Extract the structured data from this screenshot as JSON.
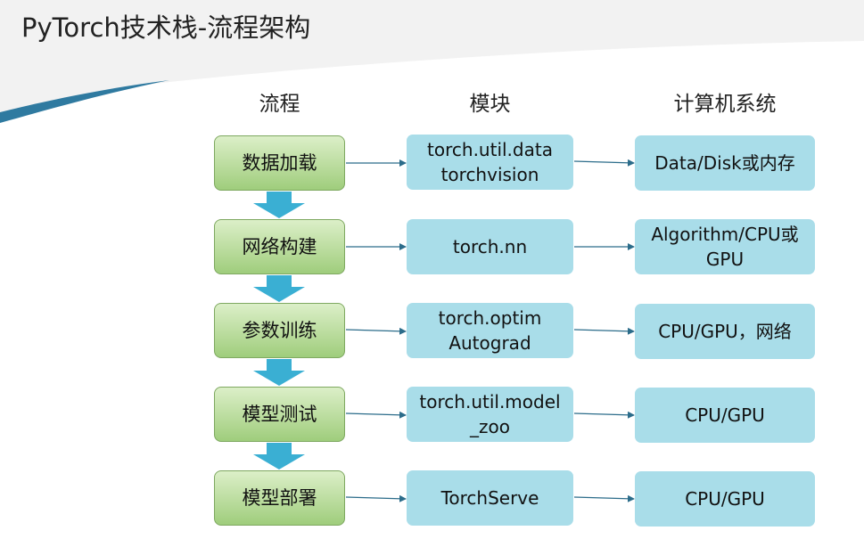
{
  "page": {
    "title": "PyTorch技术栈-流程架构"
  },
  "columns": {
    "process_header": "流程",
    "module_header": "模块",
    "system_header": "计算机系统"
  },
  "rows": [
    {
      "process": "数据加载",
      "module": "torch.util.data\ntorchvision",
      "system": "Data/Disk或内存"
    },
    {
      "process": "网络构建",
      "module": "torch.nn",
      "system": "Algorithm/CPU或\nGPU"
    },
    {
      "process": "参数训练",
      "module": "torch.optim\nAutograd",
      "system": "CPU/GPU，网络"
    },
    {
      "process": "模型测试",
      "module": "torch.util.model\n_zoo",
      "system": "CPU/GPU"
    },
    {
      "process": "模型部署",
      "module": "TorchServe",
      "system": "CPU/GPU"
    }
  ],
  "colors": {
    "process_fill_top": "#dcefc8",
    "process_fill_bottom": "#9fcd7c",
    "box_fill": "#a9dde9",
    "flow_arrow": "#3aafd3",
    "connector": "#2b6c8a",
    "deco_stripe": "#2f7aa0"
  }
}
